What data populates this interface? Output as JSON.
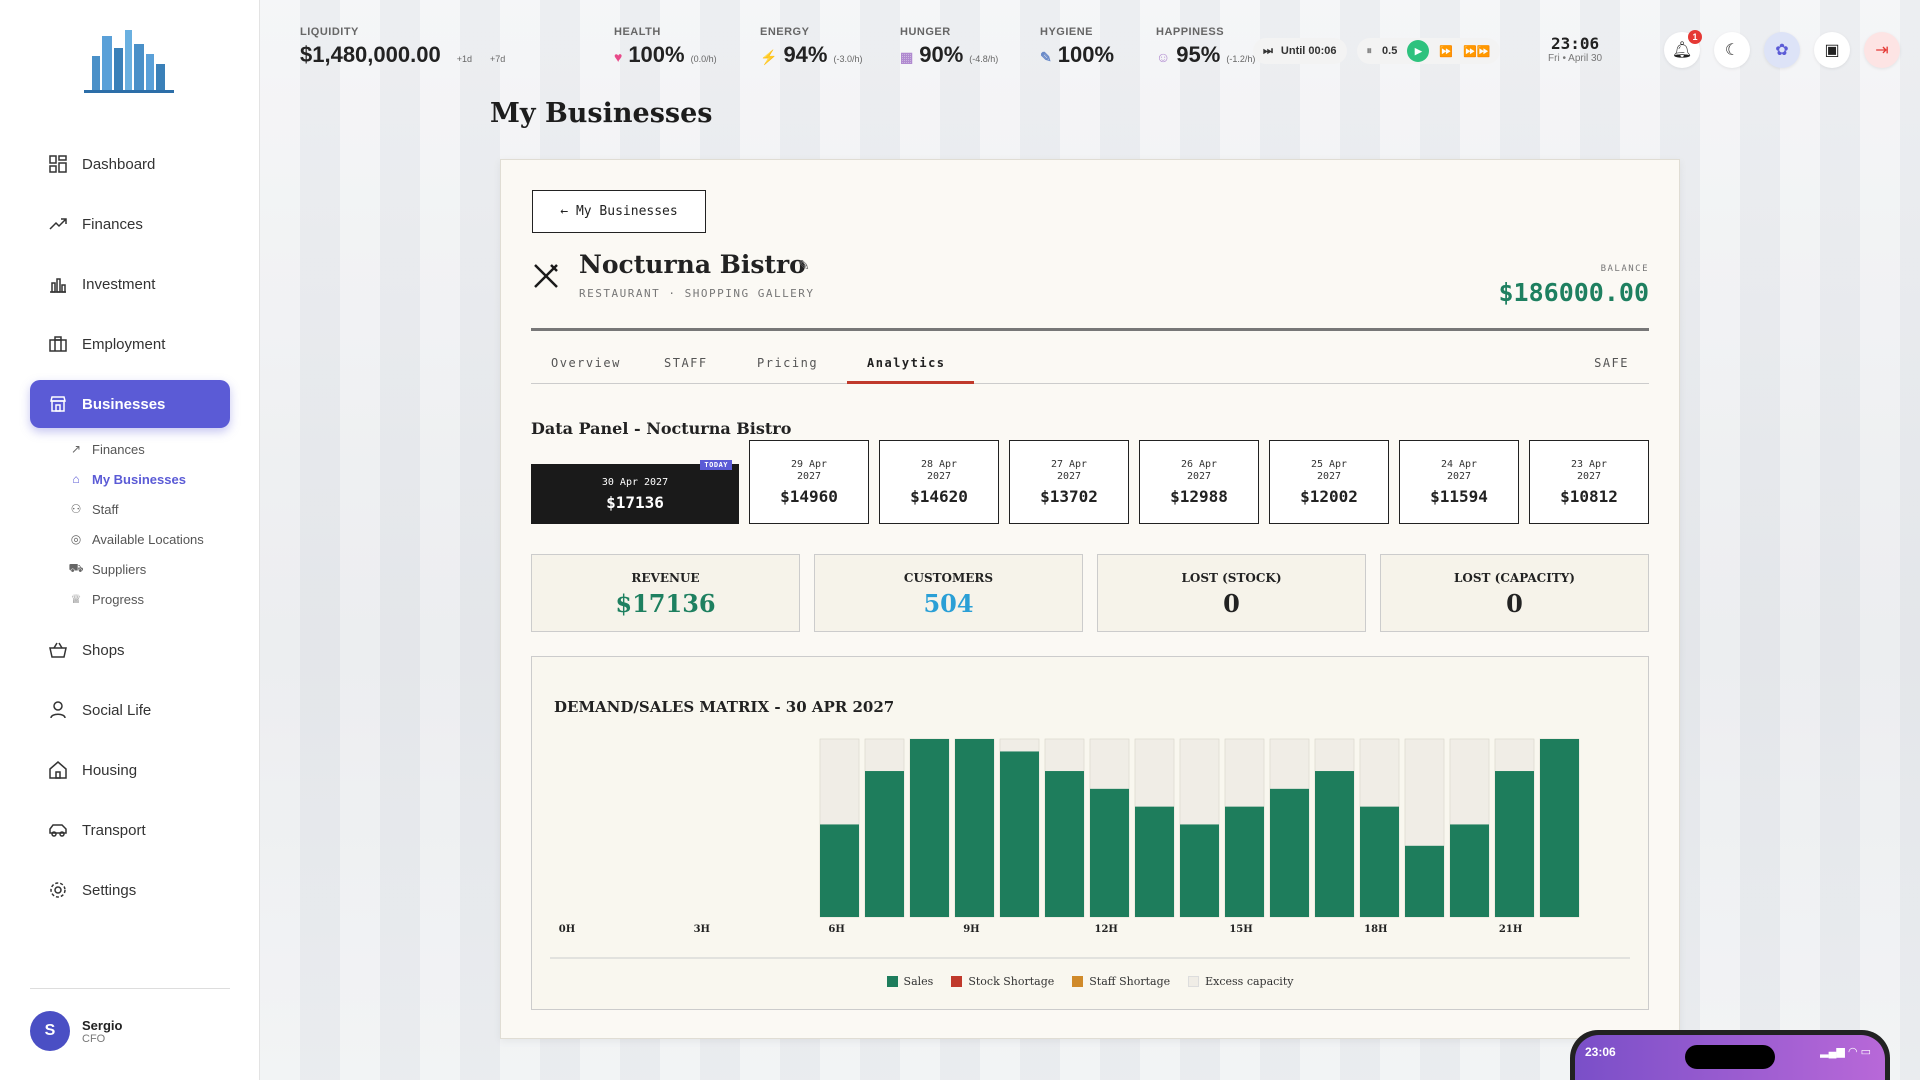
{
  "sidebar": {
    "items": [
      {
        "label": "Dashboard",
        "icon": "dashboard-icon"
      },
      {
        "label": "Finances",
        "icon": "trending-up-icon"
      },
      {
        "label": "Investment",
        "icon": "chart-icon"
      },
      {
        "label": "Employment",
        "icon": "briefcase-icon"
      },
      {
        "label": "Businesses",
        "icon": "store-icon"
      },
      {
        "label": "Shops",
        "icon": "basket-icon"
      },
      {
        "label": "Social Life",
        "icon": "person-icon"
      },
      {
        "label": "Housing",
        "icon": "home-icon"
      },
      {
        "label": "Transport",
        "icon": "car-icon"
      },
      {
        "label": "Settings",
        "icon": "gear-icon"
      }
    ],
    "subitems": [
      {
        "label": "Finances",
        "icon": "trending-up-icon"
      },
      {
        "label": "My Businesses",
        "icon": "store-icon"
      },
      {
        "label": "Staff",
        "icon": "people-icon"
      },
      {
        "label": "Available Locations",
        "icon": "location-pin-icon"
      },
      {
        "label": "Suppliers",
        "icon": "truck-icon"
      },
      {
        "label": "Progress",
        "icon": "trophy-icon"
      }
    ],
    "user": {
      "initial": "S",
      "name": "Sergio",
      "role": "CFO"
    }
  },
  "topbar": {
    "liquidity": {
      "label": "LIQUIDITY",
      "value": "$1,480,000.00",
      "d1": "+1d",
      "d7": "+7d"
    },
    "health": {
      "label": "HEALTH",
      "value": "100%",
      "rate": "(0.0/h)"
    },
    "energy": {
      "label": "ENERGY",
      "value": "94%",
      "rate": "(-3.0/h)"
    },
    "hunger": {
      "label": "HUNGER",
      "value": "90%",
      "rate": "(-4.8/h)"
    },
    "hygiene": {
      "label": "HYGIENE",
      "value": "100%"
    },
    "happiness": {
      "label": "HAPPINESS",
      "value": "95%",
      "rate": "(-1.2/h)"
    },
    "until": "Until 00:06",
    "speed": "0.5",
    "time": "23:06",
    "date": "Fri • April 30",
    "notifications": "1"
  },
  "page": {
    "title": "My Businesses"
  },
  "business": {
    "back_label": "← My Businesses",
    "name": "Nocturna Bistro",
    "subtitle": "RESTAURANT · SHOPPING GALLERY",
    "balance_label": "BALANCE",
    "balance": "$186000.00",
    "tabs": [
      "Overview",
      "STAFF",
      "Pricing",
      "Analytics"
    ],
    "tab_right": "SAFE"
  },
  "data_panel": {
    "title": "Data Panel - Nocturna Bistro",
    "today_badge": "TODAY",
    "days": [
      {
        "date": "30 Apr 2027",
        "value": "$17136"
      },
      {
        "date1": "29 Apr",
        "date2": "2027",
        "value": "$14960"
      },
      {
        "date1": "28 Apr",
        "date2": "2027",
        "value": "$14620"
      },
      {
        "date1": "27 Apr",
        "date2": "2027",
        "value": "$13702"
      },
      {
        "date1": "26 Apr",
        "date2": "2027",
        "value": "$12988"
      },
      {
        "date1": "25 Apr",
        "date2": "2027",
        "value": "$12002"
      },
      {
        "date1": "24 Apr",
        "date2": "2027",
        "value": "$11594"
      },
      {
        "date1": "23 Apr",
        "date2": "2027",
        "value": "$10812"
      }
    ],
    "metrics": [
      {
        "label": "REVENUE",
        "value": "$17136"
      },
      {
        "label": "CUSTOMERS",
        "value": "504"
      },
      {
        "label": "LOST (STOCK)",
        "value": "0"
      },
      {
        "label": "LOST (CAPACITY)",
        "value": "0"
      }
    ]
  },
  "colors": {
    "accent": "#5b5bd6",
    "sales": "#1e7d5c",
    "excess": "#f0ede6",
    "stock": "#c0392b",
    "staff": "#d08a2a",
    "revenue": "#1e8060",
    "customers": "#2a9fd6"
  },
  "chart_data": {
    "type": "bar",
    "title": "DEMAND/SALES MATRIX - 30 APR 2027",
    "x_ticks": [
      "0H",
      "3H",
      "6H",
      "9H",
      "12H",
      "15H",
      "18H",
      "21H"
    ],
    "hours": [
      6,
      7,
      8,
      9,
      10,
      11,
      12,
      13,
      14,
      15,
      16,
      17,
      18,
      19,
      20,
      21,
      22
    ],
    "series": [
      {
        "name": "Sales",
        "values": [
          0.52,
          0.82,
          1.0,
          1.0,
          0.93,
          0.82,
          0.72,
          0.62,
          0.52,
          0.62,
          0.72,
          0.82,
          0.62,
          0.4,
          0.52,
          0.82,
          1.0
        ]
      },
      {
        "name": "Stock Shortage",
        "values": [
          0,
          0,
          0,
          0,
          0,
          0,
          0,
          0,
          0,
          0,
          0,
          0,
          0,
          0,
          0,
          0,
          0
        ]
      },
      {
        "name": "Staff Shortage",
        "values": [
          0,
          0,
          0,
          0,
          0,
          0,
          0,
          0,
          0,
          0,
          0,
          0,
          0,
          0,
          0,
          0,
          0
        ]
      },
      {
        "name": "Excess capacity",
        "values": [
          0.48,
          0.18,
          0,
          0,
          0.07,
          0.18,
          0.28,
          0.38,
          0.48,
          0.38,
          0.28,
          0.18,
          0.38,
          0.6,
          0.48,
          0.18,
          0
        ]
      }
    ],
    "ylim": [
      0,
      1
    ],
    "grid": false,
    "legend": "bottom"
  }
}
